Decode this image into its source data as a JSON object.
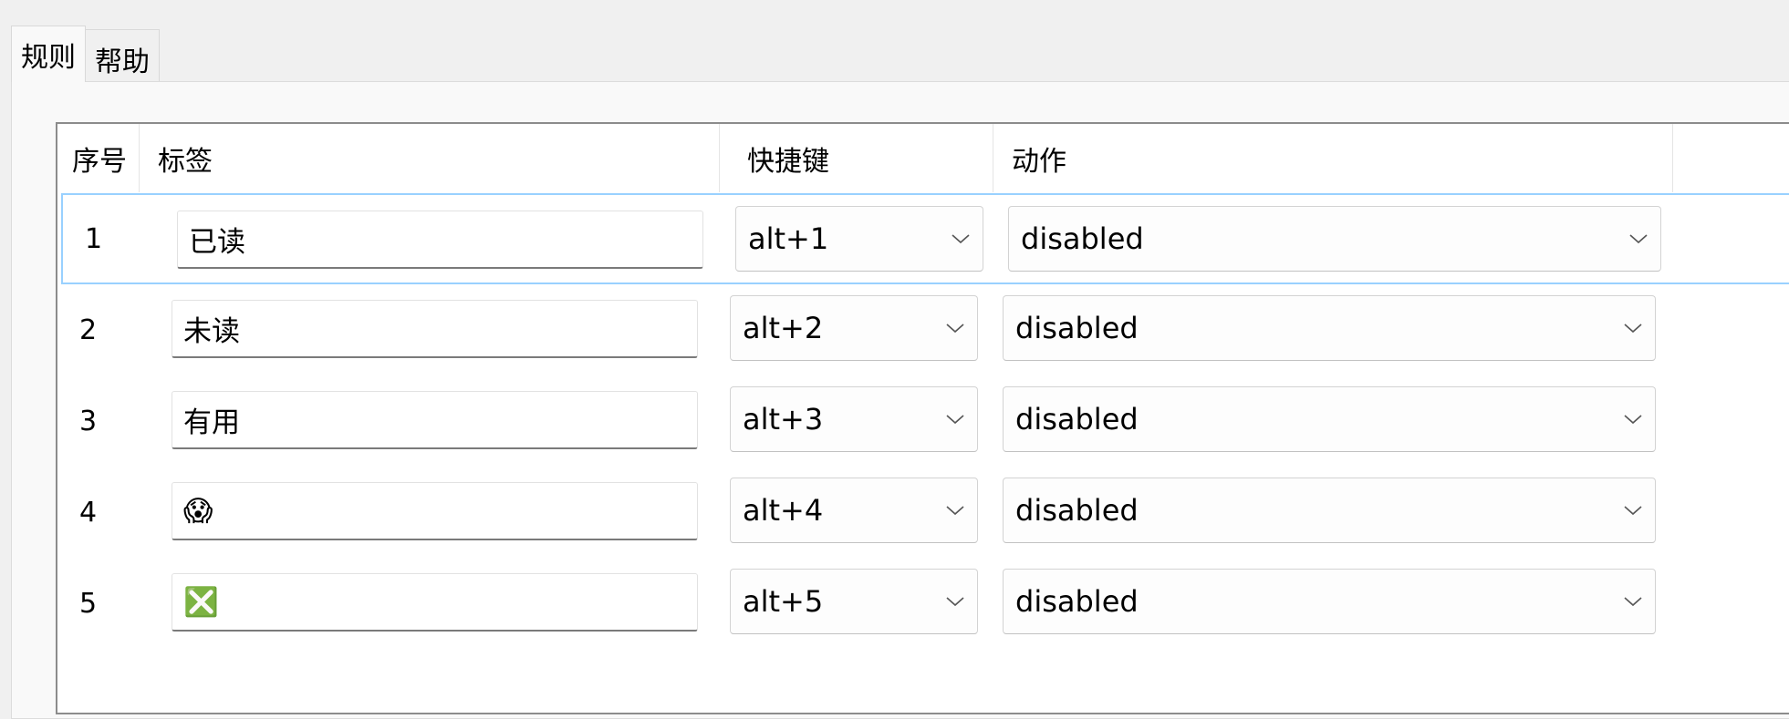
{
  "tabs": [
    {
      "label": "规则",
      "active": true
    },
    {
      "label": "帮助",
      "active": false
    }
  ],
  "table": {
    "columns": [
      "序号",
      "标签",
      "快捷键",
      "动作"
    ],
    "rows": [
      {
        "num": "1",
        "label": "已读",
        "shortcut": "alt+1",
        "action": "disabled",
        "selected": true
      },
      {
        "num": "2",
        "label": "未读",
        "shortcut": "alt+2",
        "action": "disabled",
        "selected": false
      },
      {
        "num": "3",
        "label": "有用",
        "shortcut": "alt+3",
        "action": "disabled",
        "selected": false
      },
      {
        "num": "4",
        "label": "😱",
        "shortcut": "alt+4",
        "action": "disabled",
        "selected": false
      },
      {
        "num": "5",
        "label": "❎",
        "shortcut": "alt+5",
        "action": "disabled",
        "selected": false
      }
    ]
  },
  "colors": {
    "selection_border": "#99d1ff",
    "table_border": "#8c8c8c",
    "window_bg": "#f0f0f0"
  },
  "icons": {
    "combo_arrow": "chevron-down-icon"
  }
}
